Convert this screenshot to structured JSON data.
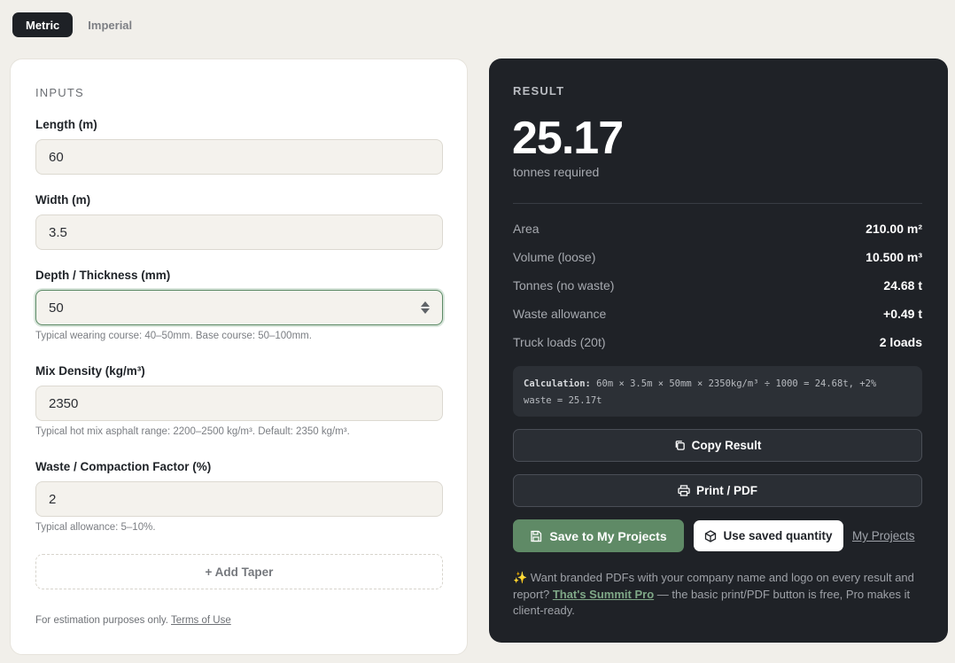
{
  "unit_toggle": {
    "metric": "Metric",
    "imperial": "Imperial"
  },
  "inputs": {
    "section_title": "INPUTS",
    "length": {
      "label": "Length (m)",
      "value": "60"
    },
    "width": {
      "label": "Width (m)",
      "value": "3.5"
    },
    "depth": {
      "label": "Depth / Thickness (mm)",
      "value": "50",
      "hint": "Typical wearing course: 40–50mm. Base course: 50–100mm."
    },
    "density": {
      "label": "Mix Density (kg/m³)",
      "value": "2350",
      "hint": "Typical hot mix asphalt range: 2200–2500 kg/m³. Default: 2350 kg/m³."
    },
    "waste": {
      "label": "Waste / Compaction Factor (%)",
      "value": "2",
      "hint": "Typical allowance: 5–10%."
    },
    "add_taper": "+ Add Taper",
    "footnote": "For estimation purposes only.",
    "terms_link": "Terms of Use"
  },
  "result": {
    "section_title": "RESULT",
    "value": "25.17",
    "unit": "tonnes required",
    "metrics": [
      {
        "label": "Area",
        "value": "210.00 m²"
      },
      {
        "label": "Volume (loose)",
        "value": "10.500 m³"
      },
      {
        "label": "Tonnes (no waste)",
        "value": "24.68 t"
      },
      {
        "label": "Waste allowance",
        "value": "+0.49 t"
      },
      {
        "label": "Truck loads (20t)",
        "value": "2 loads"
      }
    ],
    "calculation_label": "Calculation:",
    "calculation_line1": " 60m × 3.5m × 50mm × 2350kg/m³ ÷ 1000 = 24.68t, +2%",
    "calculation_line2": "waste = 25.17t",
    "copy_label": "Copy Result",
    "print_label": "Print / PDF",
    "save_label": "Save to My Projects",
    "use_saved_label": "Use saved quantity",
    "my_projects_link": "My Projects",
    "promo_emoji": "✨",
    "promo_pre": " Want branded PDFs with your company name and logo on every result and report? ",
    "promo_link": "That's Summit Pro",
    "promo_post": " — the basic print/PDF button is free, Pro makes it client-ready."
  },
  "colors": {
    "accent": "#5f8a66",
    "dark_panel": "#1f2227",
    "background": "#f1efea"
  },
  "icons": {
    "copy": "copy-icon",
    "print": "printer-icon",
    "save": "save-icon",
    "cube": "cube-icon"
  }
}
